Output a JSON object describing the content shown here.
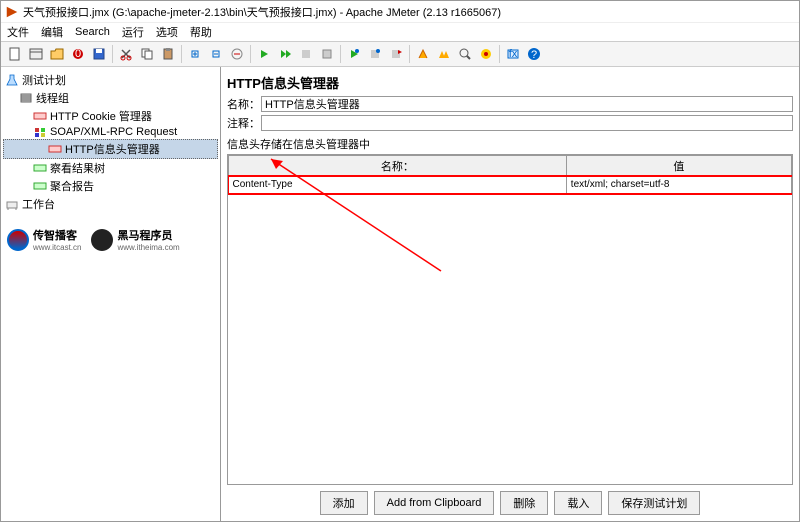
{
  "window": {
    "title": "天气预报接口.jmx (G:\\apache-jmeter-2.13\\bin\\天气预报接口.jmx) - Apache JMeter (2.13 r1665067)"
  },
  "menu": {
    "file": "文件",
    "edit": "编辑",
    "search": "Search",
    "run": "运行",
    "options": "选项",
    "help": "帮助"
  },
  "tree": {
    "root": "测试计划",
    "thread": "线程组",
    "cookie": "HTTP Cookie 管理器",
    "soap": "SOAP/XML-RPC Request",
    "header": "HTTP信息头管理器",
    "view": "察看结果树",
    "agg": "聚合报告",
    "workbench": "工作台"
  },
  "logos": {
    "l1name": "传智播客",
    "l1url": "www.itcast.cn",
    "l2name": "黑马程序员",
    "l2url": "www.itheima.com"
  },
  "panel": {
    "title": "HTTP信息头管理器",
    "nameLabel": "名称：",
    "nameValue": "HTTP信息头管理器",
    "commentLabel": "注释：",
    "commentValue": "",
    "storedLabel": "信息头存储在信息头管理器中",
    "colName": "名称：",
    "colValue": "值",
    "row1name": "Content-Type",
    "row1value": "text/xml; charset=utf-8"
  },
  "buttons": {
    "add": "添加",
    "clipboard": "Add from Clipboard",
    "delete": "删除",
    "load": "载入",
    "save": "保存测试计划"
  },
  "toolbar": {
    "count": "0"
  }
}
